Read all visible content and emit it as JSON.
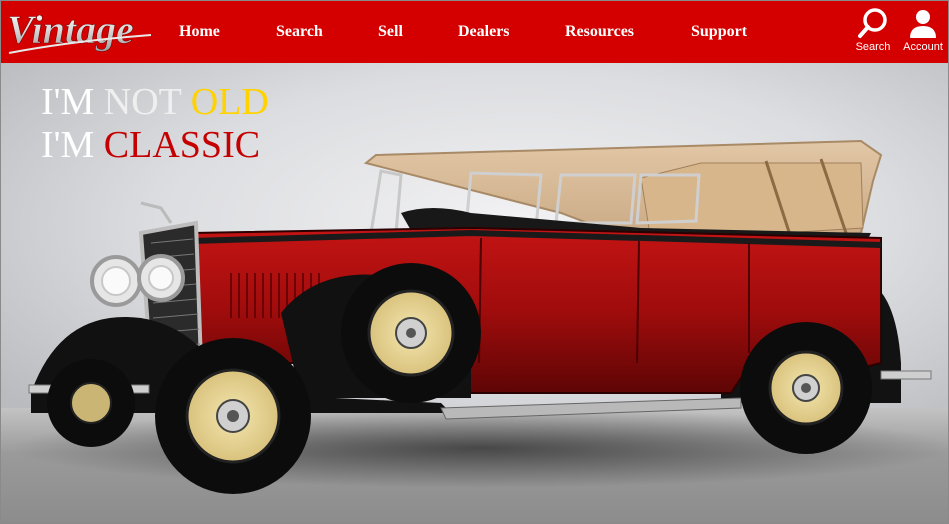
{
  "brand": {
    "logo_text": "Vintage"
  },
  "nav": [
    {
      "label": "Home"
    },
    {
      "label": "Search"
    },
    {
      "label": "Sell"
    },
    {
      "label": "Dealers"
    },
    {
      "label": "Resources"
    },
    {
      "label": "Support"
    }
  ],
  "utility": {
    "search": {
      "label": "Search",
      "icon": "magnifier-icon"
    },
    "account": {
      "label": "Account",
      "icon": "person-icon"
    }
  },
  "hero": {
    "line1": {
      "part1": "I'M",
      "part2": "NOT",
      "part3": "OLD"
    },
    "line2": {
      "part1": "I'M",
      "part2": "CLASSIC"
    },
    "image": "vintage-red-touring-car"
  },
  "colors": {
    "header_red": "#d40000",
    "accent_yellow": "#ffd200",
    "accent_red": "#c40000",
    "text_white": "#ffffff"
  }
}
